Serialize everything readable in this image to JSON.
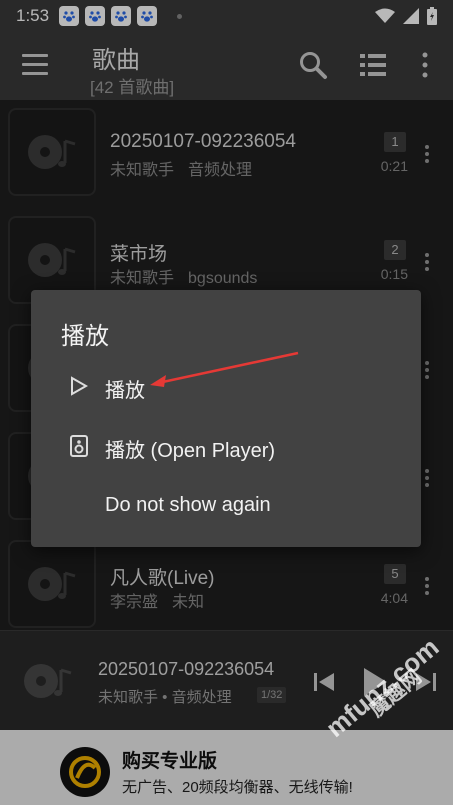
{
  "status_bar": {
    "time": "1:53",
    "app_icons": [
      "baidu-icon",
      "baidu-icon",
      "baidu-icon",
      "baidu-icon"
    ]
  },
  "toolbar": {
    "title": "歌曲",
    "subtitle": "[42 首歌曲]"
  },
  "songs": [
    {
      "title": "20250107-092236054",
      "artist": "未知歌手",
      "album": "音频处理",
      "index": "1",
      "duration": "0:21"
    },
    {
      "title": "菜市场",
      "artist": "未知歌手",
      "album": "bgsounds",
      "index": "2",
      "duration": "0:15"
    },
    {
      "title": "",
      "artist": "",
      "album": "",
      "index": "",
      "duration": ""
    },
    {
      "title": "",
      "artist": "",
      "album": "",
      "index": "",
      "duration": ""
    },
    {
      "title": "凡人歌(Live)",
      "artist": "李宗盛",
      "album": "未知",
      "index": "5",
      "duration": "4:04"
    }
  ],
  "dialog": {
    "title": "播放",
    "options": [
      {
        "label": "播放",
        "icon": "play-outline-icon"
      },
      {
        "label": "播放 (Open Player)",
        "icon": "speaker-icon"
      },
      {
        "label": "Do not show again",
        "icon": ""
      }
    ]
  },
  "mini_player": {
    "title": "20250107-092236054",
    "artist_album": "未知歌手 • 音频处理",
    "position": "1/32"
  },
  "ad": {
    "title": "购买专业版",
    "subtitle": "无广告、20频段均衡器、无线传输!"
  },
  "watermark": {
    "line1": "mfunz.com",
    "line2": "魔趣网"
  },
  "colors": {
    "accent_arrow": "#e53935",
    "dialog_bg": "#424242",
    "toolbar_bg": "#3a3a3a"
  }
}
